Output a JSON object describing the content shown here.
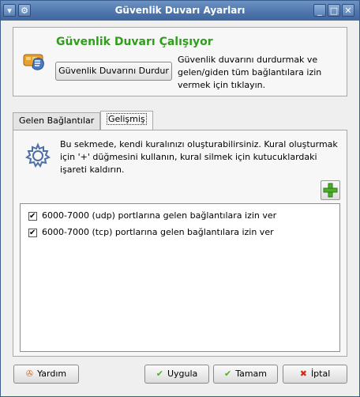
{
  "window": {
    "title": "Güvenlik Duvarı Ayarları"
  },
  "status": {
    "title": "Güvenlik Duvarı Çalışıyor",
    "stop_button": "Güvenlik Duvarını Durdur",
    "description": "Güvenlik duvarını durdurmak ve gelen/giden tüm bağlantılara izin vermek için tıklayın.",
    "accent_color": "#2f9e1b"
  },
  "tabs": [
    {
      "label": "Gelen Bağlantılar",
      "active": false
    },
    {
      "label": "Gelişmiş",
      "active": true
    }
  ],
  "advanced": {
    "info": "Bu sekmede, kendi kuralınızı oluşturabilirsiniz. Kural oluşturmak için '+' düğmesini kullanın, kural silmek için kutucuklardaki işareti kaldırın.",
    "add_icon": "plus-icon",
    "rules": [
      {
        "label": "6000-7000 (udp) portlarına gelen bağlantılara izin ver",
        "checked": true
      },
      {
        "label": "6000-7000 (tcp) portlarına gelen bağlantılara izin ver",
        "checked": true
      }
    ]
  },
  "buttons": {
    "help": "Yardım",
    "apply": "Uygula",
    "ok": "Tamam",
    "cancel": "İptal"
  }
}
